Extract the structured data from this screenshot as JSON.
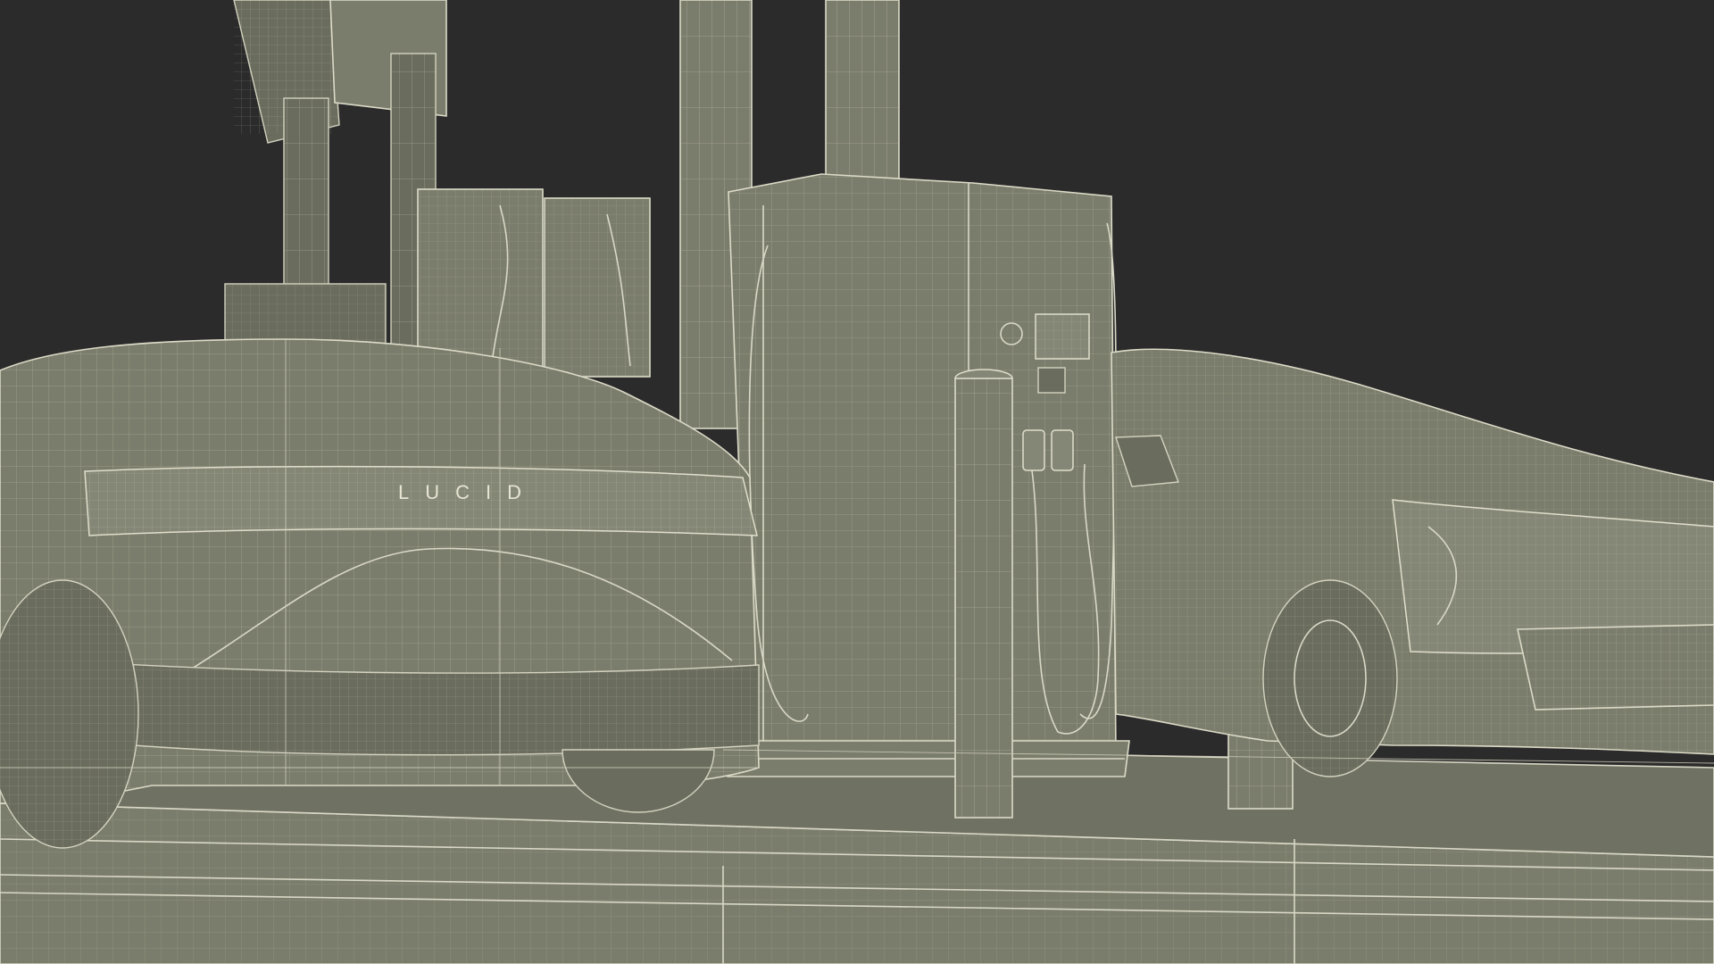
{
  "scene": {
    "background": "#2b2b2b",
    "surface_color": "#7b7d6c",
    "wire_color": "#d9d8c6"
  },
  "objects": {
    "left_car": {
      "badge": "LUCID"
    },
    "right_car": {}
  },
  "icons": [
    "charger-cable-icon",
    "plug-icon"
  ]
}
